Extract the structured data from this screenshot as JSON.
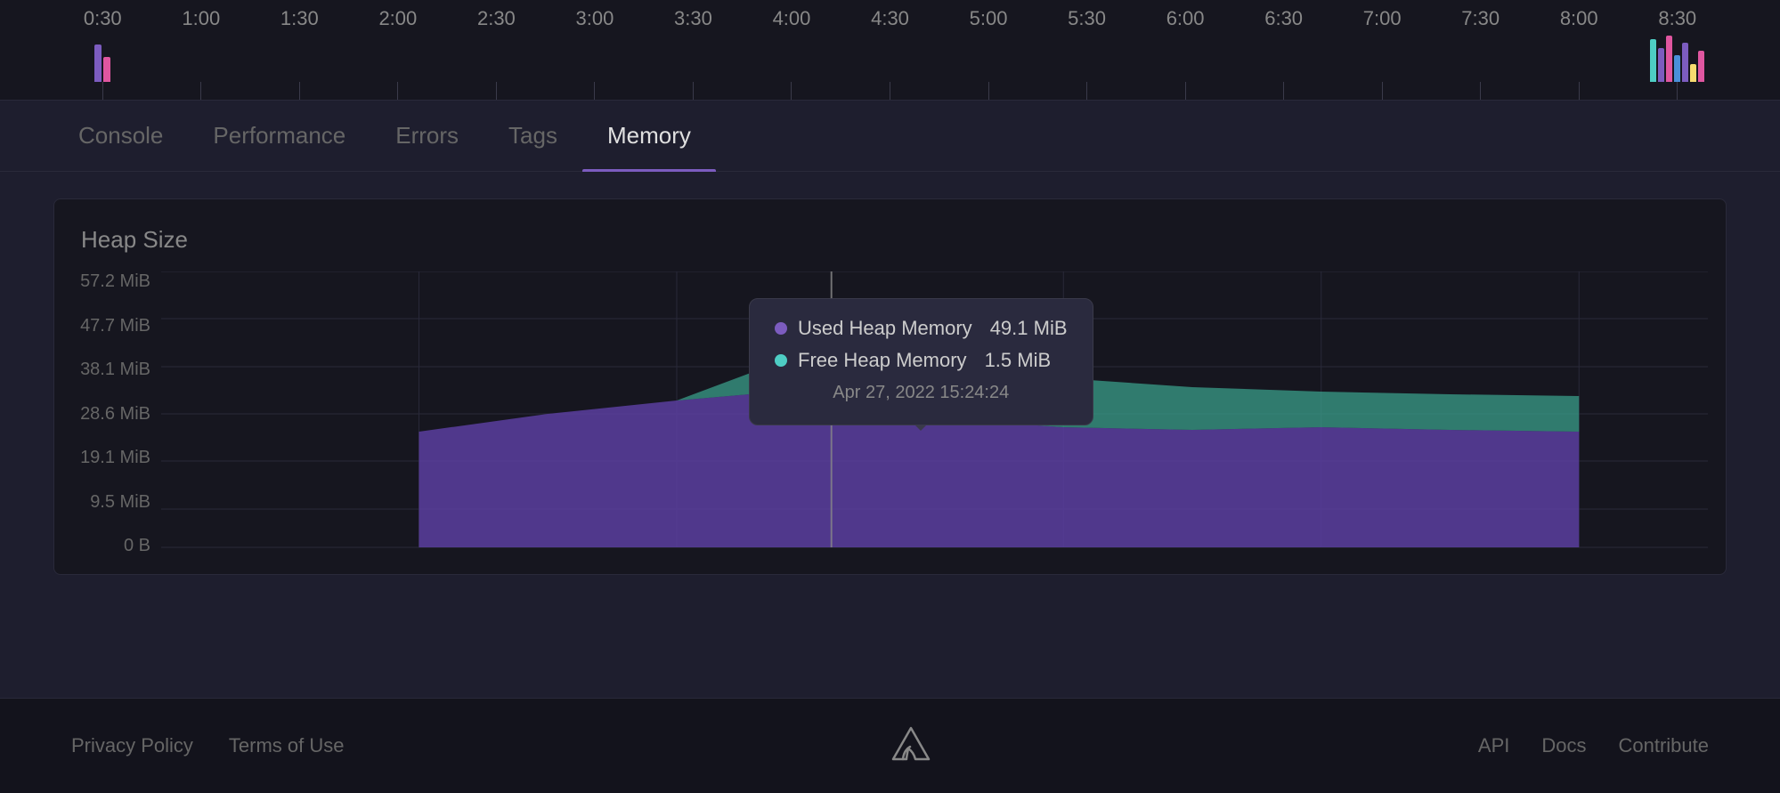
{
  "timeline": {
    "ticks": [
      "0:30",
      "1:00",
      "1:30",
      "2:00",
      "2:30",
      "3:00",
      "3:30",
      "4:00",
      "4:30",
      "5:00",
      "5:30",
      "6:00",
      "6:30",
      "7:00",
      "7:30",
      "8:00",
      "8:30"
    ]
  },
  "tabs": {
    "items": [
      {
        "label": "Console",
        "active": false
      },
      {
        "label": "Performance",
        "active": false
      },
      {
        "label": "Errors",
        "active": false
      },
      {
        "label": "Tags",
        "active": false
      },
      {
        "label": "Memory",
        "active": true
      }
    ]
  },
  "chart": {
    "title": "Heap Size",
    "y_labels": [
      "57.2 MiB",
      "47.7 MiB",
      "38.1 MiB",
      "28.6 MiB",
      "19.1 MiB",
      "9.5 MiB",
      "0 B"
    ]
  },
  "tooltip": {
    "used_label": "Used Heap Memory",
    "used_value": "49.1 MiB",
    "free_label": "Free Heap Memory",
    "free_value": "1.5 MiB",
    "date": "Apr 27, 2022 15:24:24"
  },
  "footer": {
    "privacy_policy": "Privacy Policy",
    "terms_of_use": "Terms of Use",
    "api": "API",
    "docs": "Docs",
    "contribute": "Contribute"
  }
}
